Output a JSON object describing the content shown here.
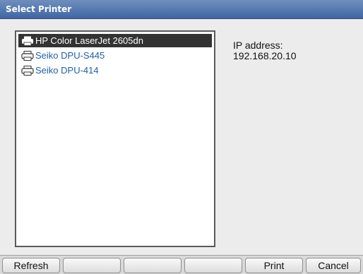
{
  "window": {
    "title": "Select Printer"
  },
  "printers": [
    {
      "name": "HP Color LaserJet 2605dn",
      "selected": true
    },
    {
      "name": "Seiko DPU-S445",
      "selected": false
    },
    {
      "name": "Seiko DPU-414",
      "selected": false
    }
  ],
  "details": {
    "ip_label": "IP address:",
    "ip_value": "192.168.20.10"
  },
  "footer": {
    "refresh_label": "Refresh",
    "soft1_label": "",
    "soft2_label": "",
    "soft3_label": "",
    "print_label": "Print",
    "cancel_label": "Cancel"
  },
  "icons": {
    "printer": "printer-icon"
  },
  "colors": {
    "titlebar": "#3f66a4",
    "selection": "#333333",
    "link_text": "#1f5fa6"
  }
}
